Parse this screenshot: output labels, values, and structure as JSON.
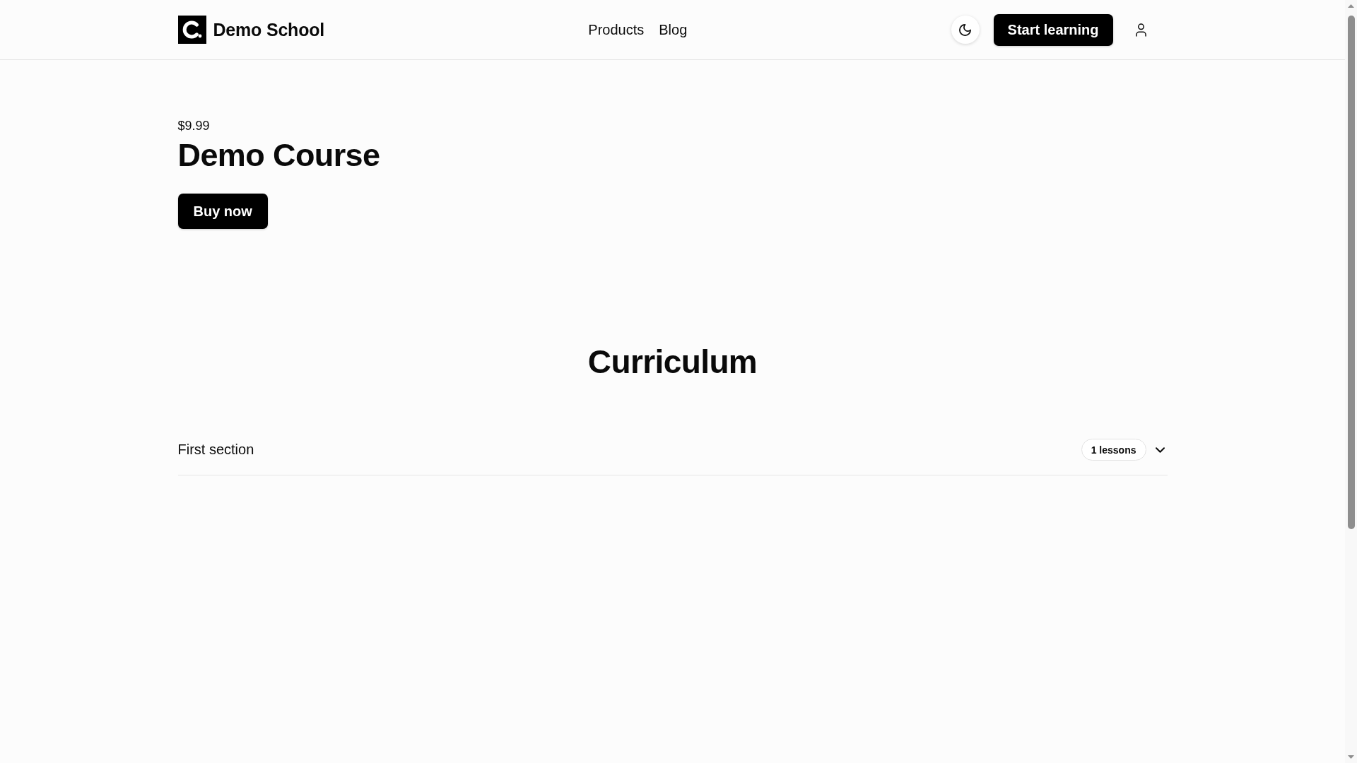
{
  "header": {
    "brand": "Demo School",
    "nav": [
      {
        "label": "Products"
      },
      {
        "label": "Blog"
      }
    ],
    "cta": "Start learning"
  },
  "course": {
    "price": "$9.99",
    "title": "Demo Course",
    "buy_button": "Buy now"
  },
  "curriculum": {
    "title": "Curriculum",
    "sections": [
      {
        "title": "First section",
        "lesson_count": "1 lessons",
        "expanded": false
      }
    ]
  }
}
